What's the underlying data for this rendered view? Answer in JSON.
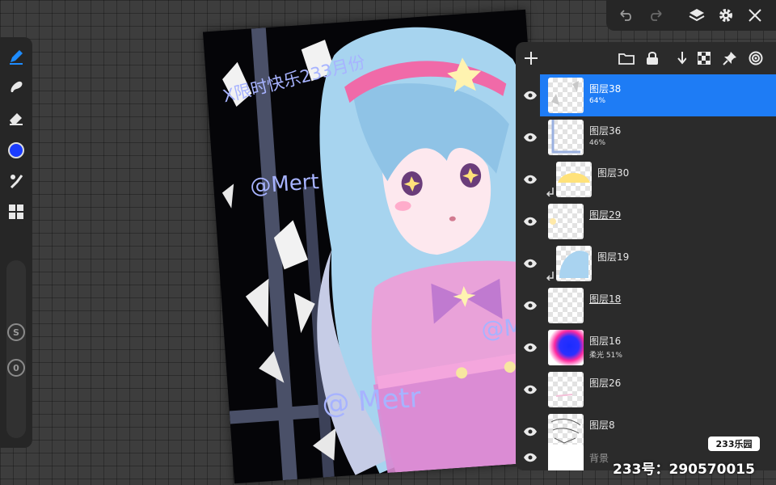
{
  "app": {
    "accent_color": "#1e7cf5",
    "brush_color": "#1a3cff"
  },
  "toolbar": {
    "tools": [
      {
        "name": "pen-tool-icon",
        "active": true
      },
      {
        "name": "smudge-tool-icon",
        "active": false
      },
      {
        "name": "eraser-tool-icon",
        "active": false
      },
      {
        "name": "color-picker-icon",
        "active": false
      },
      {
        "name": "brush-settings-icon",
        "active": false
      },
      {
        "name": "gallery-grid-icon",
        "active": false
      }
    ],
    "size_label": "S",
    "opacity_label": "0"
  },
  "topbar": {
    "icons": [
      "undo-icon",
      "redo-icon",
      "layers-icon",
      "settings-icon",
      "close-icon"
    ]
  },
  "canvas": {
    "watermarks": [
      "X限时快乐233月份",
      "@Mert",
      "@ Metr",
      "@M"
    ]
  },
  "layers_panel": {
    "header_icons": [
      "add-layer-icon",
      "folder-icon",
      "lock-icon",
      "merge-down-icon",
      "checkerboard-icon",
      "pin-icon",
      "target-icon"
    ],
    "layers": [
      {
        "name": "图层38",
        "sub": "64%",
        "selected": true,
        "clipped": false,
        "underline": false,
        "visible": true
      },
      {
        "name": "图层36",
        "sub": "46%",
        "selected": false,
        "clipped": false,
        "underline": false,
        "visible": true
      },
      {
        "name": "图层30",
        "sub": "",
        "selected": false,
        "clipped": true,
        "underline": false,
        "visible": true
      },
      {
        "name": "图层29",
        "sub": "",
        "selected": false,
        "clipped": false,
        "underline": true,
        "visible": true
      },
      {
        "name": "图层19",
        "sub": "",
        "selected": false,
        "clipped": true,
        "underline": false,
        "visible": true
      },
      {
        "name": "图层18",
        "sub": "",
        "selected": false,
        "clipped": false,
        "underline": true,
        "visible": true
      },
      {
        "name": "图层16",
        "sub": "柔光  51%",
        "selected": false,
        "clipped": false,
        "underline": false,
        "visible": true
      },
      {
        "name": "图层26",
        "sub": "",
        "selected": false,
        "clipped": false,
        "underline": false,
        "visible": true
      },
      {
        "name": "图层8",
        "sub": "",
        "selected": false,
        "clipped": false,
        "underline": false,
        "visible": true
      },
      {
        "name": "背景",
        "sub": "",
        "selected": false,
        "clipped": false,
        "underline": false,
        "visible": true
      }
    ]
  },
  "watermark": {
    "badge": "233乐园",
    "id_text": "233号：290570015"
  }
}
